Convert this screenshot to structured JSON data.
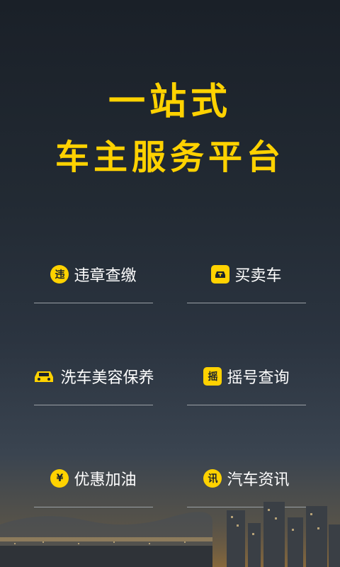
{
  "headline": {
    "line1": "一站式",
    "line2": "车主服务平台"
  },
  "features": [
    {
      "label": "违章查缴",
      "icon": "违",
      "icon_name": "violation-icon"
    },
    {
      "label": "买卖车",
      "icon": "",
      "icon_name": "trade-car-icon"
    },
    {
      "label": "洗车美容保养",
      "icon": "",
      "icon_name": "car-wash-icon"
    },
    {
      "label": "摇号查询",
      "icon": "摇",
      "icon_name": "lottery-icon"
    },
    {
      "label": "优惠加油",
      "icon": "¥",
      "icon_name": "fuel-discount-icon"
    },
    {
      "label": "汽车资讯",
      "icon": "讯",
      "icon_name": "news-icon"
    }
  ],
  "colors": {
    "accent": "#ffd200",
    "text": "#ffffff",
    "divider": "#9aa0a6"
  }
}
